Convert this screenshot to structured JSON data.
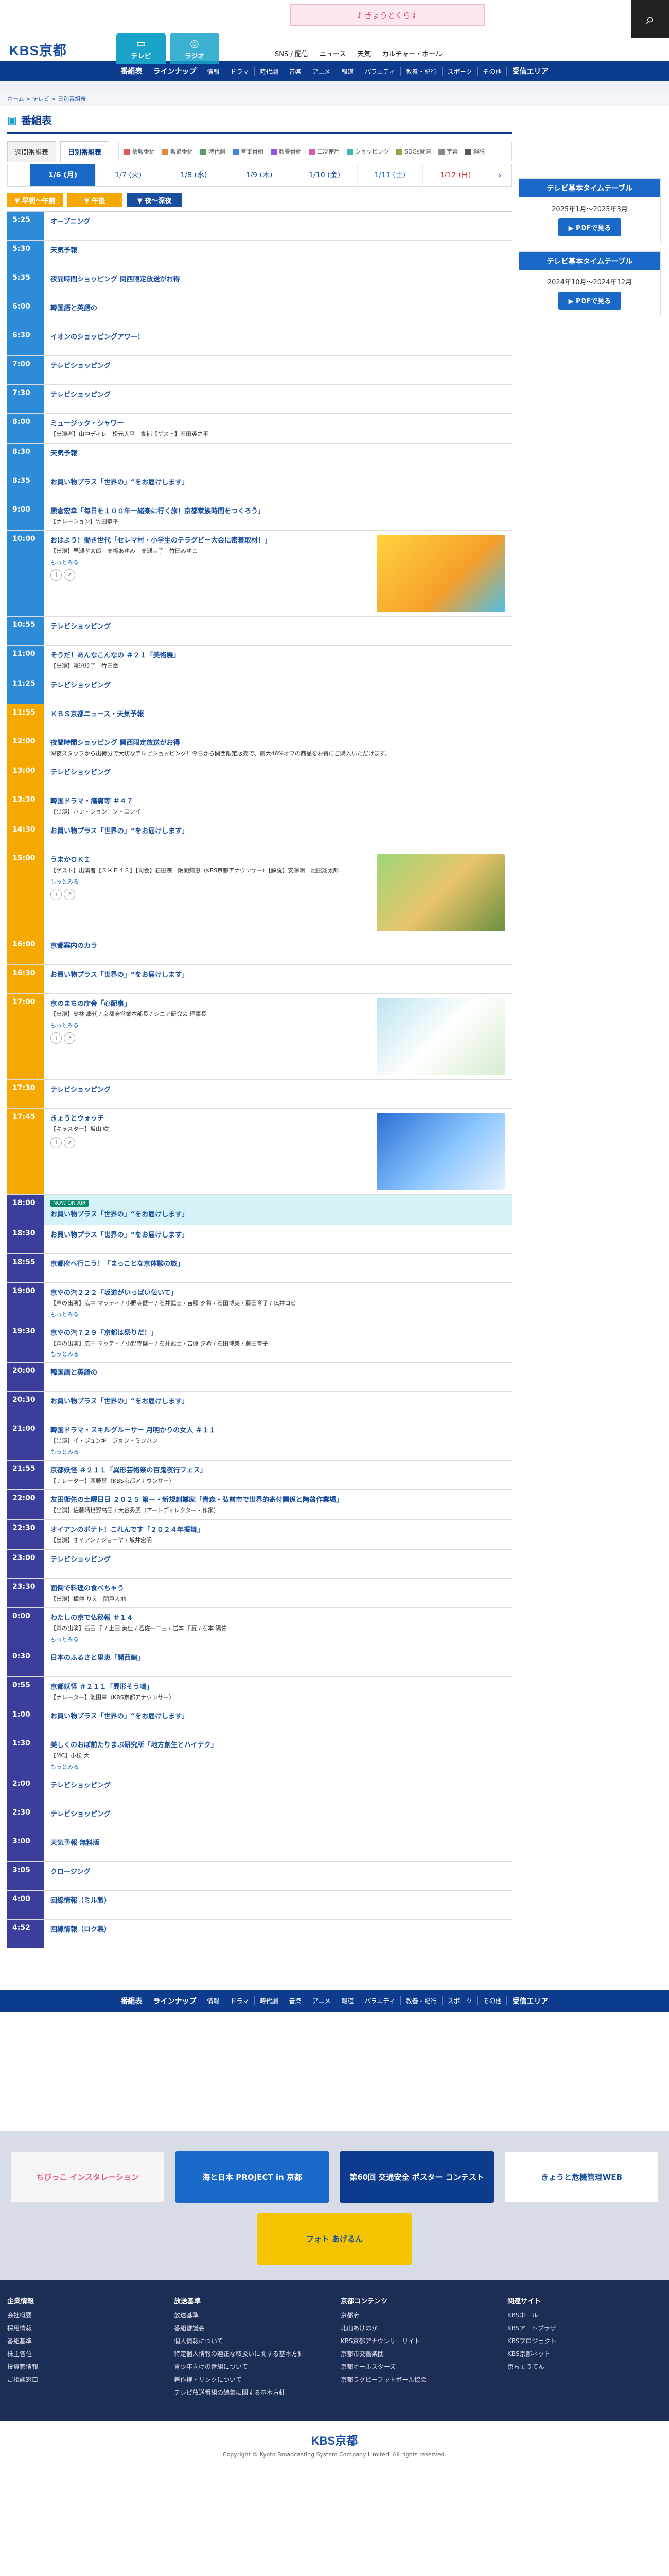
{
  "header": {
    "logo": "KBS京都",
    "banner": "♪ きょうとくらす",
    "tv": "テレビ",
    "radio": "ラジオ",
    "links": [
      "SNS / 配信",
      "ニュース",
      "天気",
      "カルチャー・ホール"
    ]
  },
  "gnav": [
    "番組表",
    "ラインナップ",
    "情報",
    "ドラマ",
    "時代劇",
    "音楽",
    "アニメ",
    "報道",
    "バラエティ",
    "教養・紀行",
    "スポーツ",
    "その他",
    "受信エリア"
  ],
  "breadcrumb": "ホーム > テレビ > 日別番組表",
  "page": {
    "title": "番組表"
  },
  "tabs": {
    "weekly": "週間番組表",
    "daily": "日別番組表"
  },
  "legend": [
    "情報番組",
    "報道番組",
    "時代劇",
    "音楽番組",
    "教養番組",
    "二次使用",
    "ショッピング",
    "SDGs関連",
    "字幕",
    "解説"
  ],
  "dates": [
    "1/6 (月)",
    "1/7 (火)",
    "1/8 (水)",
    "1/9 (木)",
    "1/10 (金)",
    "1/11 (土)",
    "1/12 (日)"
  ],
  "periods": [
    "▼ 早朝～午前",
    "▼ 午後",
    "▼ 夜～深夜"
  ],
  "schedule": [
    {
      "time": "5:25",
      "title": "オープニング",
      "p": "morn"
    },
    {
      "time": "5:30",
      "title": "天気予報",
      "p": "morn"
    },
    {
      "time": "5:35",
      "title": "夜間時間ショッピング 関西限定放送がお得",
      "p": "morn"
    },
    {
      "time": "6:00",
      "title": "韓国語と英語の",
      "p": "morn"
    },
    {
      "time": "6:30",
      "title": "イオンのショッピングアワー！",
      "p": "morn"
    },
    {
      "time": "7:00",
      "title": "テレビショッピング",
      "p": "morn"
    },
    {
      "time": "7:30",
      "title": "テレビショッピング",
      "p": "morn"
    },
    {
      "time": "8:00",
      "title": "ミュージック・シャワー",
      "desc": "【出演者】山中ディレ　松元大平　實補【ゲスト】石田英之平",
      "p": "morn"
    },
    {
      "time": "8:30",
      "title": "天気予報",
      "p": "morn"
    },
    {
      "time": "8:35",
      "title": "お買い物プラス「世界の」“をお届けします」",
      "p": "morn"
    },
    {
      "time": "9:00",
      "title": "熊倉宏幸「毎日を１００年一緒楽に行く旅！京都家族時間をつくろう」",
      "desc": "【ナレーション】竹田恭平",
      "p": "morn"
    },
    {
      "time": "10:00",
      "title": "おはよう！働き世代「セレマ村・小学生のテラグビー大会に密着取材！」",
      "desc": "【出演】早瀬孝太郎　高橋あゆみ　高瀬幸子　竹田みゆこ",
      "thumb": "th1",
      "more": "もっとみる",
      "p": "morn"
    },
    {
      "time": "10:55",
      "title": "テレビショッピング",
      "p": "morn"
    },
    {
      "time": "11:00",
      "title": "そうだ！あんなこんなの ＃２１「美術展」",
      "desc": "【出演】渡辺玲子　竹田章",
      "p": "morn"
    },
    {
      "time": "11:25",
      "title": "テレビショッピング",
      "p": "morn"
    },
    {
      "time": "11:55",
      "title": "ＫＢＳ京都ニュース・天気予報",
      "p": "day"
    },
    {
      "time": "12:00",
      "title": "夜間時間ショッピング 関西限定放送がお得",
      "desc": "深夜スタッフから出荷分で大切なテレビショッピング！今日から関西限定販売で、最大46%オフの商品をお得にご購入いただけます。",
      "p": "day"
    },
    {
      "time": "13:00",
      "title": "テレビショッピング",
      "p": "day"
    },
    {
      "time": "13:30",
      "title": "韓国ドラマ・痛痛等 ＃４７",
      "desc": "【出演】ハン・ジョン　ソ・ユンイ",
      "p": "day"
    },
    {
      "time": "14:30",
      "title": "お買い物プラス「世界の」“をお届けします」",
      "p": "day"
    },
    {
      "time": "15:00",
      "title": "うまかＯＫＩ",
      "desc": "【ゲスト】出演者【ＳＫＥ４８】【司会】石田宗　阪間知恵（KBS京都アナウンサー）【解説】安藤潤　池田翔太郎",
      "thumb": "th2",
      "more": "もっとみる",
      "p": "day"
    },
    {
      "time": "16:00",
      "title": "京都案内のカラ",
      "p": "day"
    },
    {
      "time": "16:30",
      "title": "お買い物プラス「世界の」“をお届けします」",
      "p": "day"
    },
    {
      "time": "17:00",
      "title": "京のまちの庁舎「心配事」",
      "desc": "【出演】奥林 康代 / 京都府営業本部長 / シニア研究会 理事長",
      "thumb": "th3",
      "more": "もっとみる",
      "p": "eve"
    },
    {
      "time": "17:30",
      "title": "テレビショッピング",
      "p": "eve"
    },
    {
      "time": "17:45",
      "title": "きょうとウォッチ",
      "desc": "【キャスター】坂山 咲",
      "thumb": "th4",
      "p": "eve"
    },
    {
      "time": "18:00",
      "title": "お買い物プラス「世界の」“をお届けします」",
      "new": "NOW ON AIR",
      "hl": true,
      "p": "night"
    },
    {
      "time": "18:30",
      "title": "お買い物プラス「世界の」“をお届けします」",
      "p": "night"
    },
    {
      "time": "18:55",
      "title": "京都府へ行こう！「まっことな京体験の旅」",
      "p": "night"
    },
    {
      "time": "19:00",
      "title": "京やの汽２２２「坂道がいっぱい伝いて」",
      "desc": "【声の出演】広中 マッティ / 小野寺健一 / 石井武士 / 吉藤 夕希 / 石田博美 / 藤田育子 / 仏井ロビ",
      "more": "もっとみる",
      "p": "night"
    },
    {
      "time": "19:30",
      "title": "京やの汽７２９「京都は祭りだ！」",
      "desc": "【声の出演】広中 マッティ / 小野寺健一 / 石井武士 / 吉藤 夕希 / 石田博美 / 藤田育子",
      "more": "もっとみる",
      "p": "night"
    },
    {
      "time": "20:00",
      "title": "韓国語と英語の",
      "p": "night"
    },
    {
      "time": "20:30",
      "title": "お買い物プラス「世界の」“をお届けします」",
      "p": "night"
    },
    {
      "time": "21:00",
      "title": "韓国ドラマ・スキルグルーサー 月明かりの女人 ＃１１",
      "desc": "【出演】イ・ジュンギ　ジョン・ミンハン",
      "more": "もっとみる",
      "p": "night"
    },
    {
      "time": "21:55",
      "title": "京都妖怪 ＃２１１「異形芸術祭の百鬼夜行フェス」",
      "desc": "【ナレーター】西野葉（KBS京都アナウンサー）",
      "p": "night"
    },
    {
      "time": "22:00",
      "title": "友田衛先の土曜日日 ２０２５ 第一・新規創業家「青森・弘前市で世界的寄付関係と陶藩作業場」",
      "desc": "【出演】佐藤晴世野高田 / 大谷秀武（アートディレクター・作家）",
      "p": "night"
    },
    {
      "time": "22:30",
      "title": "オイアンのポテト！これんです「２０２４年振舞」",
      "desc": "【出演】オイアン / ジョーヤ / 坂井宏明",
      "p": "night"
    },
    {
      "time": "23:00",
      "title": "テレビショッピング",
      "p": "late"
    },
    {
      "time": "23:30",
      "title": "面倒で料理の食べちゃう",
      "desc": "【出演】橘仲 りえ　関戸大地",
      "p": "late"
    },
    {
      "time": "0:00",
      "title": "わたしの京で仏秘報 ＃１４",
      "desc": "【声の出演】石田 千 / 上田 美佳 / 若佐一二三 / 岩本 千夏 / 石本 陽佑",
      "more": "もっとみる",
      "p": "late"
    },
    {
      "time": "0:30",
      "title": "日本のふるさと里恵「関西編」",
      "p": "late"
    },
    {
      "time": "0:55",
      "title": "京都妖怪 ＃２１１「異形そう鳴」",
      "desc": "【ナレーター】池田章（KBS京都アナウンサー）",
      "p": "late"
    },
    {
      "time": "1:00",
      "title": "お買い物プラス「世界の」“をお届けします」",
      "p": "late"
    },
    {
      "time": "1:30",
      "title": "美しくのおぼ前たりまぶ研究所「地方創生とハイテク」",
      "desc": "【MC】小松 大",
      "more": "もっとみる",
      "p": "late"
    },
    {
      "time": "2:00",
      "title": "テレビショッピング",
      "p": "late"
    },
    {
      "time": "2:30",
      "title": "テレビショッピング",
      "p": "late"
    },
    {
      "time": "3:00",
      "title": "天気予報 無料版",
      "p": "late"
    },
    {
      "time": "3:05",
      "title": "クロージング",
      "p": "late"
    },
    {
      "time": "4:00",
      "title": "回線情報（ミル製）",
      "p": "late"
    },
    {
      "time": "4:52",
      "title": "回線情報（ロク製）",
      "p": "late"
    }
  ],
  "side": [
    {
      "head": "テレビ基本タイムテーブル",
      "body": "2025年1月～2025年3月",
      "btn": "PDFで見る"
    },
    {
      "head": "テレビ基本タイムテーブル",
      "body": "2024年10月～2024年12月",
      "btn": "PDFで見る"
    }
  ],
  "banners": [
    "ちびっこ インスタレーション",
    "海と日本 PROJECT in 京都",
    "第60回 交通安全 ポスター コンテスト",
    "きょうと危機管理WEB",
    "フォト あげるん"
  ],
  "foot_cols": [
    {
      "h": "企業情報",
      "items": [
        "会社概要",
        "採用情報",
        "番組基準",
        "株主各位",
        "投資家情報",
        "ご相談窓口"
      ]
    },
    {
      "h": "放送基準",
      "items": [
        "放送基準",
        "番組審議会",
        "個人情報について",
        "特定個人情報の適正な取扱いに関する基本方針",
        "青少年向けの番組について",
        "著作権・リンクについて",
        "テレビ放送番組の編集に関する基本方針"
      ]
    },
    {
      "h": "京都コンテンツ",
      "items": [
        "京都府",
        "北山あけのか",
        "KBS京都アナウンサーサイト",
        "京都市交響楽団",
        "京都オールスターズ",
        "京都ラグビーフットボール協会"
      ]
    },
    {
      "h": "関連サイト",
      "items": [
        "KBSホール",
        "KBSアートプラザ",
        "KBSプロジェクト",
        "KBS京都ネット",
        "京ちょうてん"
      ]
    }
  ],
  "copyright": "Copyright © Kyoto Broadcasting System Company Limited. All rights reserved."
}
